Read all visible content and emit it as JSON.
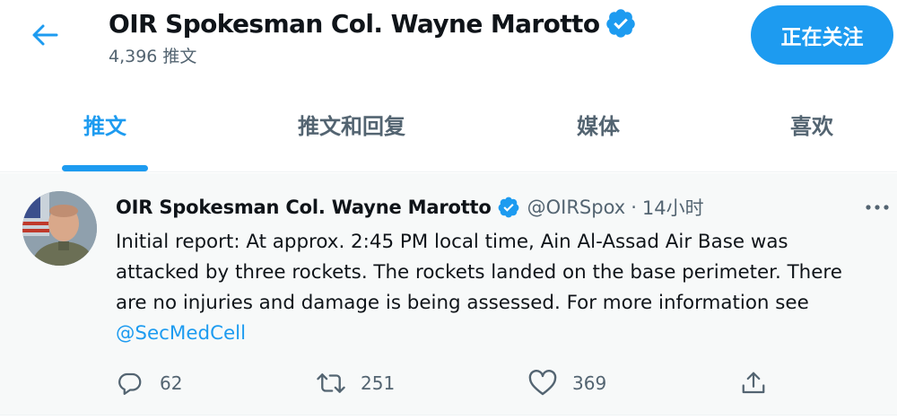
{
  "header": {
    "title": "OIR Spokesman Col. Wayne Marotto",
    "tweet_count": "4,396 推文",
    "follow_label": "正在关注"
  },
  "tabs": [
    {
      "label": "推文",
      "active": true
    },
    {
      "label": "推文和回复",
      "active": false
    },
    {
      "label": "媒体",
      "active": false
    },
    {
      "label": "喜欢",
      "active": false
    }
  ],
  "tweet": {
    "author_name": "OIR Spokesman Col. Wayne Marotto",
    "handle": "@OIRSpox",
    "separator": "·",
    "time": "14小时",
    "text_lines": [
      "Initial report: At approx. 2:45 PM local time, Ain Al-Assad Air Base was",
      "attacked by three rockets. The rockets landed on the base perimeter. There",
      "are no injuries and damage is being assessed. For more information see"
    ],
    "mention": "@SecMedCell",
    "replies": "62",
    "retweets": "251",
    "likes": "369"
  },
  "colors": {
    "accent": "#1d9bf0",
    "text": "#0f1419",
    "secondary": "#536471",
    "tweet_bg": "#f7f9f9"
  },
  "icons": [
    "back-arrow-icon",
    "verified-badge-icon",
    "more-icon",
    "reply-icon",
    "retweet-icon",
    "like-icon",
    "share-icon"
  ]
}
